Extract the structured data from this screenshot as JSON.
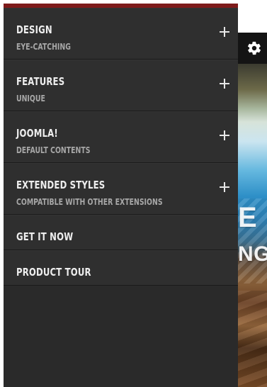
{
  "menu": {
    "items": [
      {
        "title": "DESIGN",
        "subtitle": "EYE-CATCHING",
        "has_children": true
      },
      {
        "title": "FEATURES",
        "subtitle": "UNIQUE",
        "has_children": true
      },
      {
        "title": "JOOMLA!",
        "subtitle": "DEFAULT CONTENTS",
        "has_children": true
      },
      {
        "title": "EXTENDED STYLES",
        "subtitle": "COMPATIBLE WITH OTHER EXTENSIONS",
        "has_children": true
      },
      {
        "title": "GET IT NOW",
        "subtitle": "",
        "has_children": false
      },
      {
        "title": "PRODUCT TOUR",
        "subtitle": "",
        "has_children": false
      }
    ]
  },
  "background": {
    "top_icon": "gear-icon",
    "hero_text_line1": "E",
    "hero_text_line2": "NG"
  },
  "colors": {
    "sidebar_bg": "#2a2a2a",
    "sidebar_item_bg": "#2f2f2f",
    "accent_top_border": "#7e1b1b",
    "text_primary": "#eeeeee",
    "text_secondary": "#a7a7a7"
  }
}
